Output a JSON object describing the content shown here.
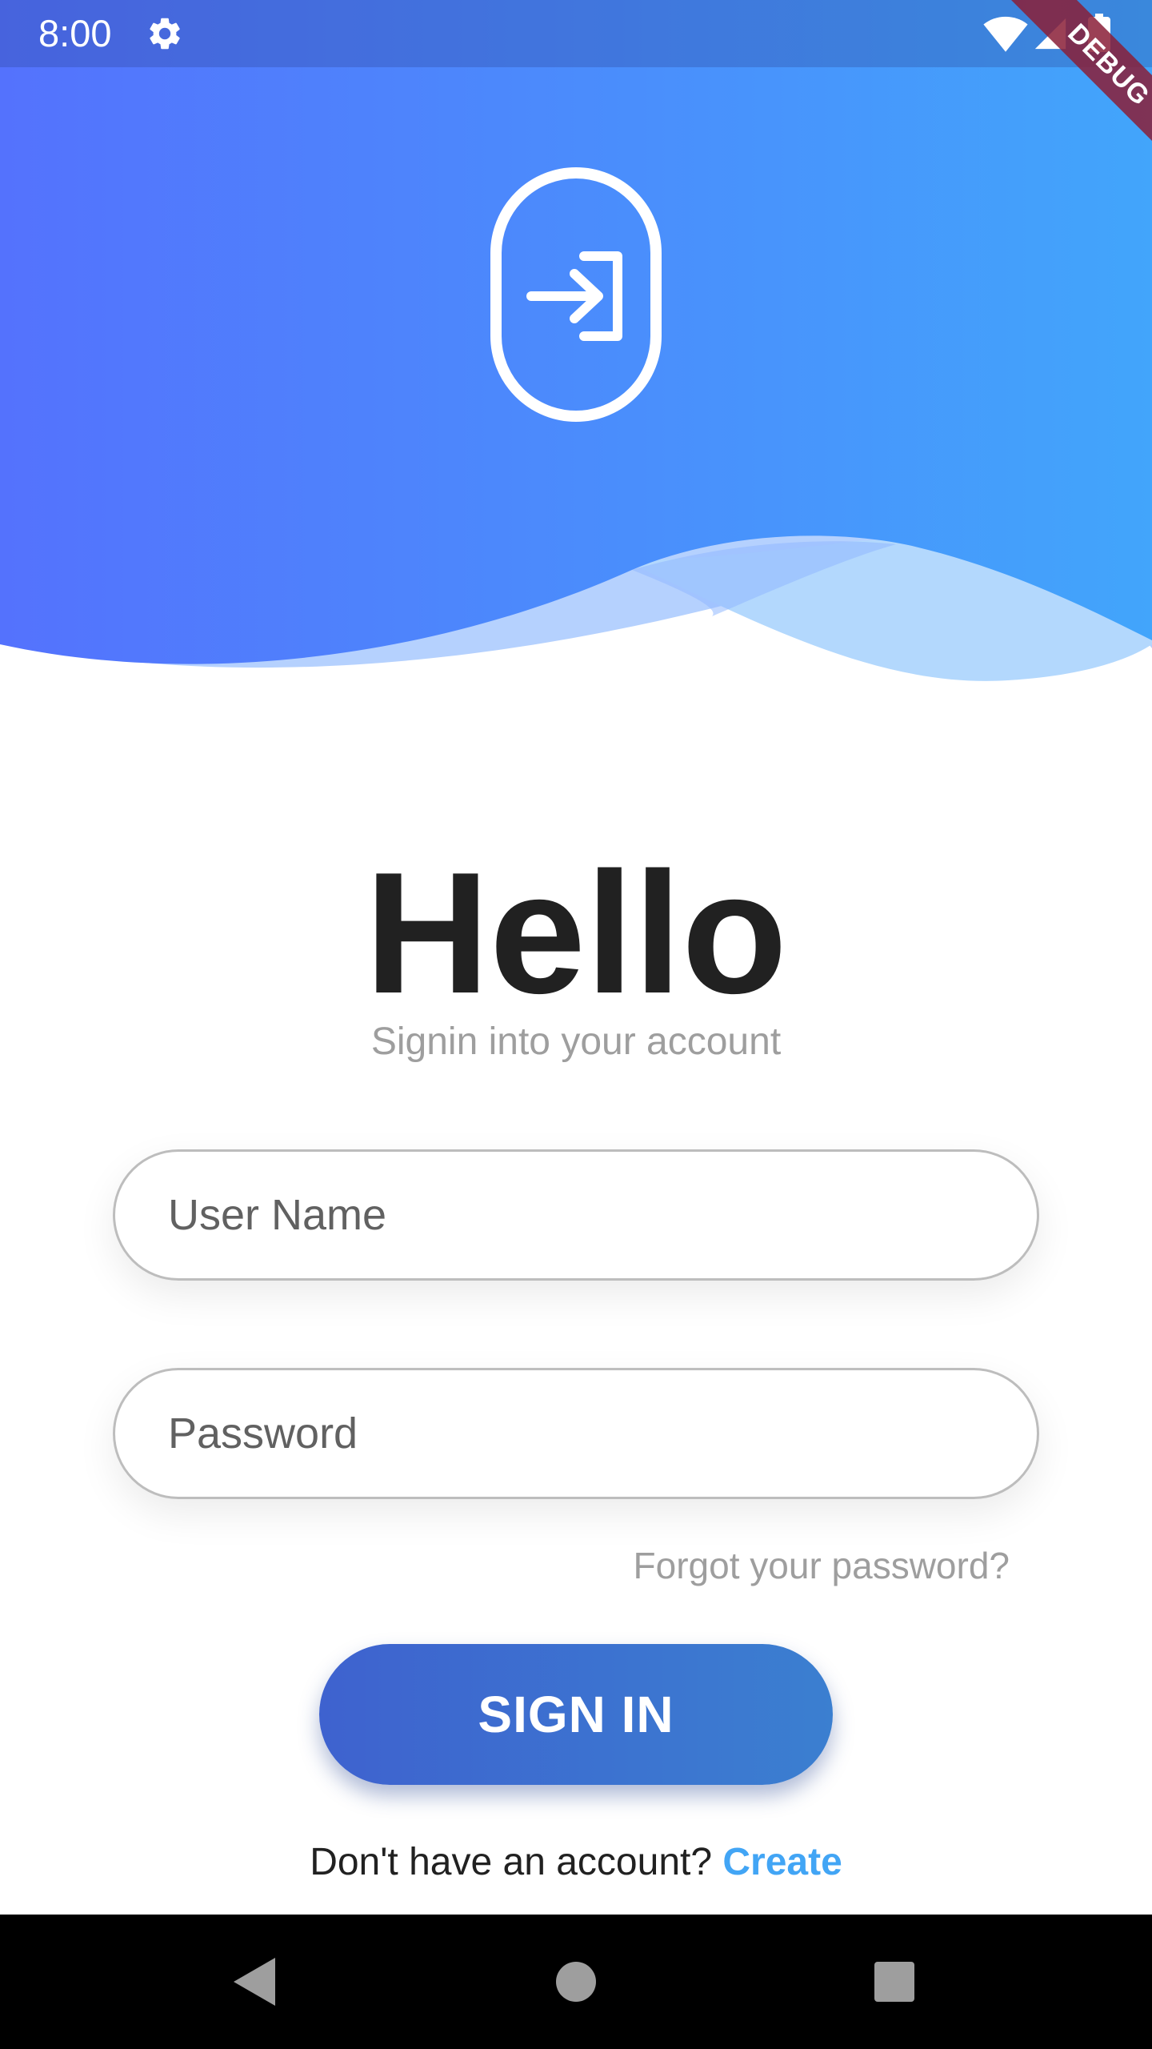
{
  "status_bar": {
    "time": "8:00",
    "icons": [
      "gear-icon",
      "wifi-icon",
      "signal-icon",
      "battery-icon"
    ]
  },
  "debug_banner": "DEBUG",
  "header": {
    "icon": "login-icon",
    "gradient_colors": [
      "#5472fd",
      "#42a5fb"
    ],
    "wave_colors": [
      "#8fb8ff",
      "#b3d8fd"
    ]
  },
  "title": "Hello",
  "subtitle": "Signin into your account",
  "form": {
    "username_placeholder": "User Name",
    "password_placeholder": "Password",
    "forgot_label": "Forgot your password?",
    "signin_label": "SIGN IN"
  },
  "signup": {
    "prompt": "Don't have an account?",
    "link_label": "Create"
  },
  "colors": {
    "accent": "#42a5f5",
    "button_start": "#3e62cf",
    "button_end": "#3b7fd0",
    "title": "#212121",
    "muted": "#9e9e9e"
  },
  "nav_bar": {
    "icons": [
      "back-icon",
      "home-icon",
      "recents-icon"
    ]
  }
}
